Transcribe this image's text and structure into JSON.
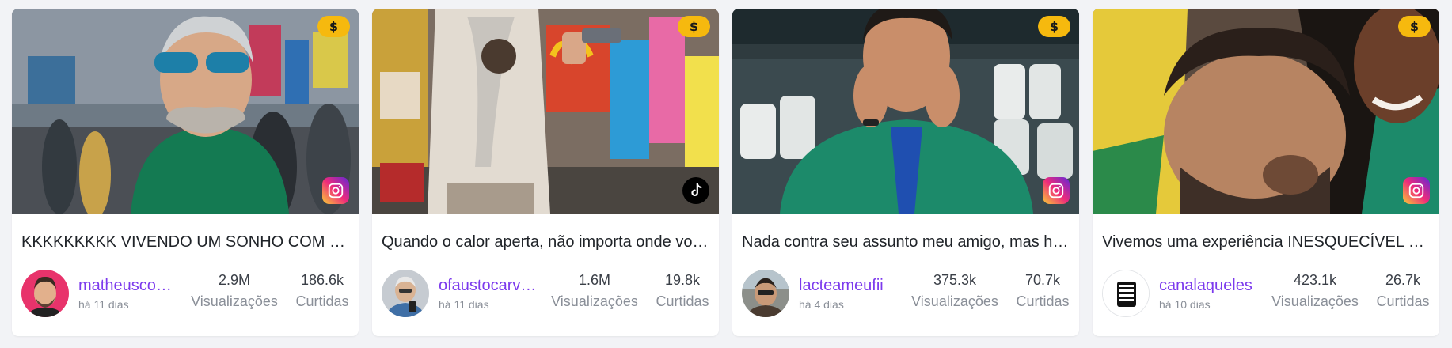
{
  "colors": {
    "accent_handle": "#7c3aed",
    "monetized_badge": "#f6b90e",
    "page_bg": "#f2f3f6"
  },
  "cards": [
    {
      "platform": "instagram-icon",
      "badge": "$",
      "title": "KKKKKKKKK VIVENDO UM SONHO COM GALERA",
      "handle": "matheuscosta",
      "age": "há 11 dias",
      "views": "2.9M",
      "views_label": "Visualizações",
      "likes": "186.6k",
      "likes_label": "Curtidas"
    },
    {
      "platform": "tiktok-icon",
      "badge": "$",
      "title": "Quando o calor aperta, não importa onde você esteja",
      "handle": "ofaustocarvalho",
      "age": "há 11 dias",
      "views": "1.6M",
      "views_label": "Visualizações",
      "likes": "19.8k",
      "likes_label": "Curtidas"
    },
    {
      "platform": "instagram-icon",
      "badge": "$",
      "title": "Nada contra seu assunto meu amigo, mas hoje não",
      "handle": "lacteameufii",
      "age": "há 4 dias",
      "views": "375.3k",
      "views_label": "Visualizações",
      "likes": "70.7k",
      "likes_label": "Curtidas"
    },
    {
      "platform": "instagram-icon",
      "badge": "$",
      "title": "Vivemos uma experiência INESQUECÍVEL no estádio",
      "handle": "canalaqueles",
      "age": "há 10 dias",
      "views": "423.1k",
      "views_label": "Visualizações",
      "likes": "26.7k",
      "likes_label": "Curtidas"
    }
  ]
}
